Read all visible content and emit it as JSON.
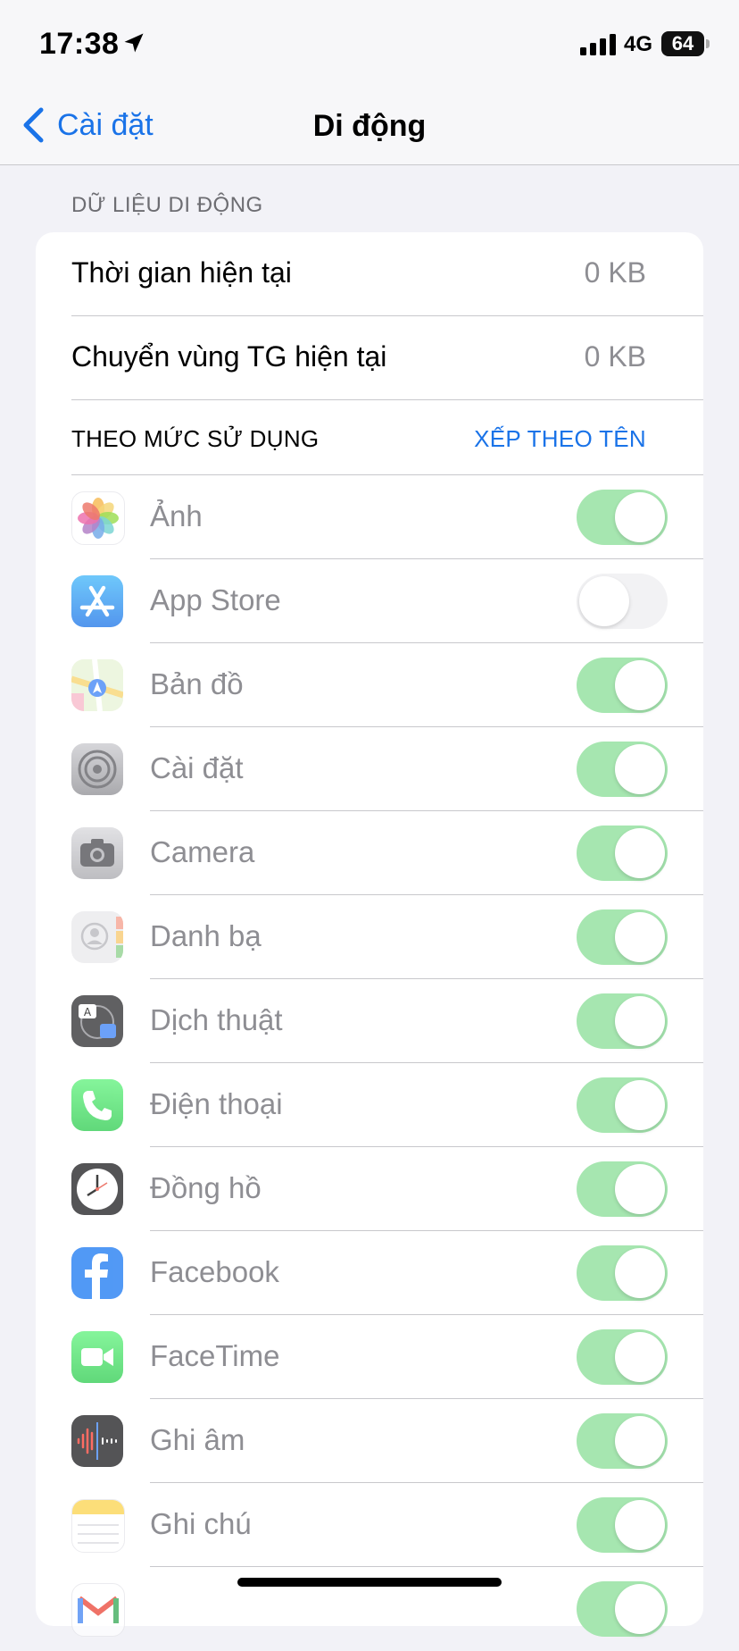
{
  "status_bar": {
    "time": "17:38",
    "network": "4G",
    "battery": "64"
  },
  "nav": {
    "back_label": "Cài đặt",
    "title": "Di động"
  },
  "section_header": "DỮ LIỆU DI ĐỘNG",
  "usage": [
    {
      "label": "Thời gian hiện tại",
      "value": "0 KB"
    },
    {
      "label": "Chuyển vùng TG hiện tại",
      "value": "0 KB"
    }
  ],
  "sort": {
    "left": "THEO MỨC SỬ DỤNG",
    "right": "XẾP THEO TÊN"
  },
  "apps": [
    {
      "name": "Ảnh",
      "enabled": true,
      "icon": "photos-icon"
    },
    {
      "name": "App Store",
      "enabled": false,
      "icon": "app-store-icon"
    },
    {
      "name": "Bản đồ",
      "enabled": true,
      "icon": "maps-icon"
    },
    {
      "name": "Cài đặt",
      "enabled": true,
      "icon": "settings-gear-icon"
    },
    {
      "name": "Camera",
      "enabled": true,
      "icon": "camera-icon"
    },
    {
      "name": "Danh bạ",
      "enabled": true,
      "icon": "contacts-icon"
    },
    {
      "name": "Dịch thuật",
      "enabled": true,
      "icon": "translate-icon"
    },
    {
      "name": "Điện thoại",
      "enabled": true,
      "icon": "phone-icon"
    },
    {
      "name": "Đồng hồ",
      "enabled": true,
      "icon": "clock-icon"
    },
    {
      "name": "Facebook",
      "enabled": true,
      "icon": "facebook-icon"
    },
    {
      "name": "FaceTime",
      "enabled": true,
      "icon": "facetime-icon"
    },
    {
      "name": "Ghi âm",
      "enabled": true,
      "icon": "voice-memos-icon"
    },
    {
      "name": "Ghi chú",
      "enabled": true,
      "icon": "notes-icon"
    },
    {
      "name": "",
      "enabled": true,
      "icon": "gmail-icon"
    }
  ],
  "colors": {
    "accent": "#1a73e8",
    "toggle_on": "#a6e6b0",
    "toggle_off": "#f2f2f4"
  }
}
